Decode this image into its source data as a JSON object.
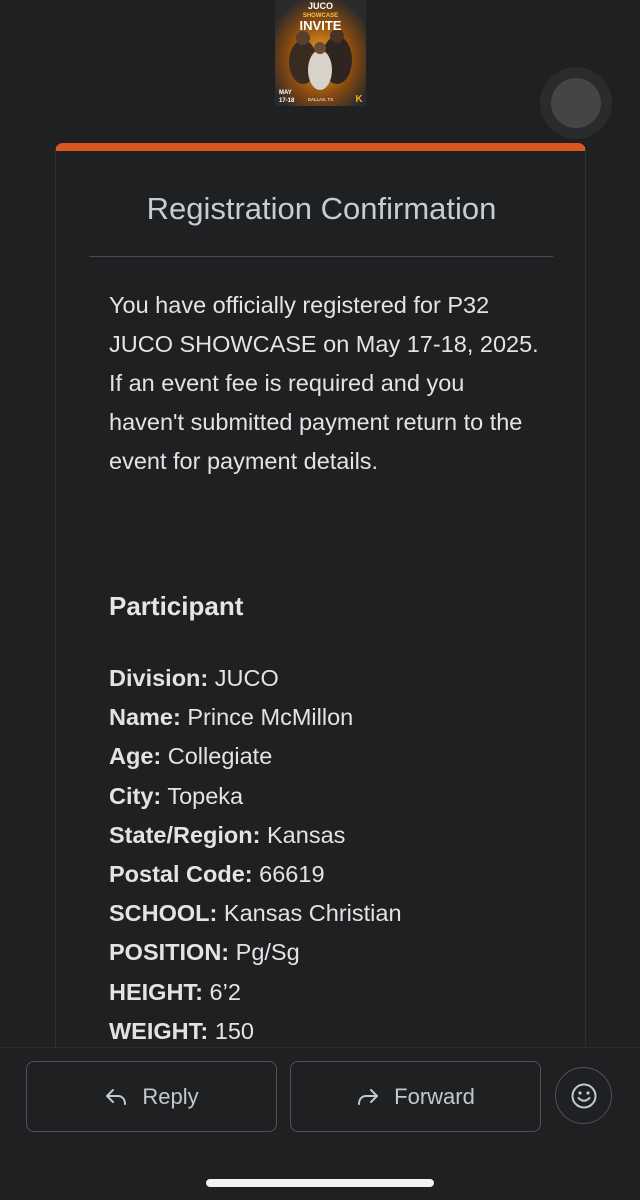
{
  "poster": {
    "title_lines": [
      "JUCO",
      "SHOWCASE",
      "INVITE"
    ],
    "date_line1": "MAY",
    "date_line2": "17-18",
    "location": "DALLAS, TX",
    "logo_letter": "K"
  },
  "card": {
    "title": "Registration Confirmation",
    "intro": "You have officially registered for P32 JUCO SHOWCASE on May 17-18, 2025. If an event fee is required and you haven't submitted payment return to the event for payment details.",
    "section_title": "Participant",
    "fields": [
      {
        "label": "Division:",
        "value": "JUCO"
      },
      {
        "label": "Name:",
        "value": "Prince McMillon"
      },
      {
        "label": "Age:",
        "value": "Collegiate"
      },
      {
        "label": "City:",
        "value": "Topeka"
      },
      {
        "label": "State/Region:",
        "value": "Kansas"
      },
      {
        "label": "Postal Code:",
        "value": "66619"
      },
      {
        "label": "SCHOOL:",
        "value": "Kansas Christian"
      },
      {
        "label": "POSITION:",
        "value": "Pg/Sg"
      },
      {
        "label": "HEIGHT:",
        "value": "6’2"
      },
      {
        "label": "WEIGHT:",
        "value": "150"
      }
    ]
  },
  "actions": {
    "reply_label": "Reply",
    "forward_label": "Forward",
    "reply_icon": "reply-arrow-icon",
    "forward_icon": "forward-arrow-icon",
    "emoji_icon": "smiley-face-icon"
  },
  "colors": {
    "accent": "#d9581f",
    "background": "#1f2022"
  }
}
